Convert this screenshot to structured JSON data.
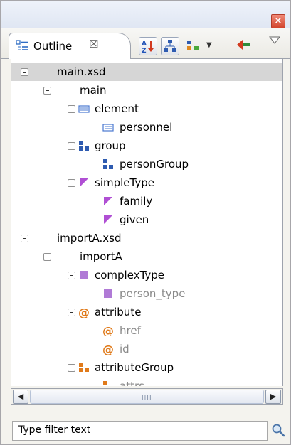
{
  "window": {
    "close_symbol": "×"
  },
  "tab": {
    "icon": "outline-icon",
    "label": "Outline",
    "close_symbol": "☒"
  },
  "toolbar": {
    "sort_icon": "sort-alphabetical-icon",
    "group_icon": "hierarchy-icon",
    "filter_icon": "filter-types-icon",
    "collapse_icon": "collapse-all-icon",
    "menu_icon": "view-menu-icon"
  },
  "colors": {
    "element": "#4a78d0",
    "group": "#2e5bb0",
    "simple_type": "#b04fd4",
    "complex_type": "#b07ad6",
    "attribute": "#e07a1a",
    "selection": "#d6d6d6"
  },
  "tree": [
    {
      "label": "main.xsd",
      "depth": 0,
      "icon": "",
      "dim": false,
      "selected": true
    },
    {
      "label": "main",
      "depth": 1,
      "icon": "",
      "dim": false,
      "selected": false
    },
    {
      "label": "element",
      "depth": 2,
      "icon": "element-icon",
      "dim": false,
      "selected": false
    },
    {
      "label": "personnel",
      "depth": 3,
      "icon": "element-icon",
      "dim": false,
      "selected": false
    },
    {
      "label": "group",
      "depth": 2,
      "icon": "group-icon",
      "dim": false,
      "selected": false
    },
    {
      "label": "personGroup",
      "depth": 3,
      "icon": "group-icon",
      "dim": false,
      "selected": false
    },
    {
      "label": "simpleType",
      "depth": 2,
      "icon": "simple-type-icon",
      "dim": false,
      "selected": false
    },
    {
      "label": "family",
      "depth": 3,
      "icon": "simple-type-icon",
      "dim": false,
      "selected": false
    },
    {
      "label": "given",
      "depth": 3,
      "icon": "simple-type-icon",
      "dim": false,
      "selected": false
    },
    {
      "label": "importA.xsd",
      "depth": 0,
      "icon": "",
      "dim": false,
      "selected": false
    },
    {
      "label": "importA",
      "depth": 1,
      "icon": "",
      "dim": false,
      "selected": false
    },
    {
      "label": "complexType",
      "depth": 2,
      "icon": "complex-type-icon",
      "dim": false,
      "selected": false
    },
    {
      "label": "person_type",
      "depth": 3,
      "icon": "complex-type-icon",
      "dim": true,
      "selected": false
    },
    {
      "label": "attribute",
      "depth": 2,
      "icon": "attribute-icon",
      "dim": false,
      "selected": false
    },
    {
      "label": "href",
      "depth": 3,
      "icon": "attribute-icon",
      "dim": true,
      "selected": false
    },
    {
      "label": "id",
      "depth": 3,
      "icon": "attribute-icon",
      "dim": true,
      "selected": false
    },
    {
      "label": "attributeGroup",
      "depth": 2,
      "icon": "attribute-group-icon",
      "dim": false,
      "selected": false
    },
    {
      "label": "attrs",
      "depth": 3,
      "icon": "attribute-group-icon",
      "dim": true,
      "selected": false
    }
  ],
  "scrollbar": {
    "left_symbol": "◀",
    "right_symbol": "▶",
    "grip_symbol": "IIII"
  },
  "filter": {
    "placeholder": "Type filter text",
    "search_icon": "search-icon"
  }
}
